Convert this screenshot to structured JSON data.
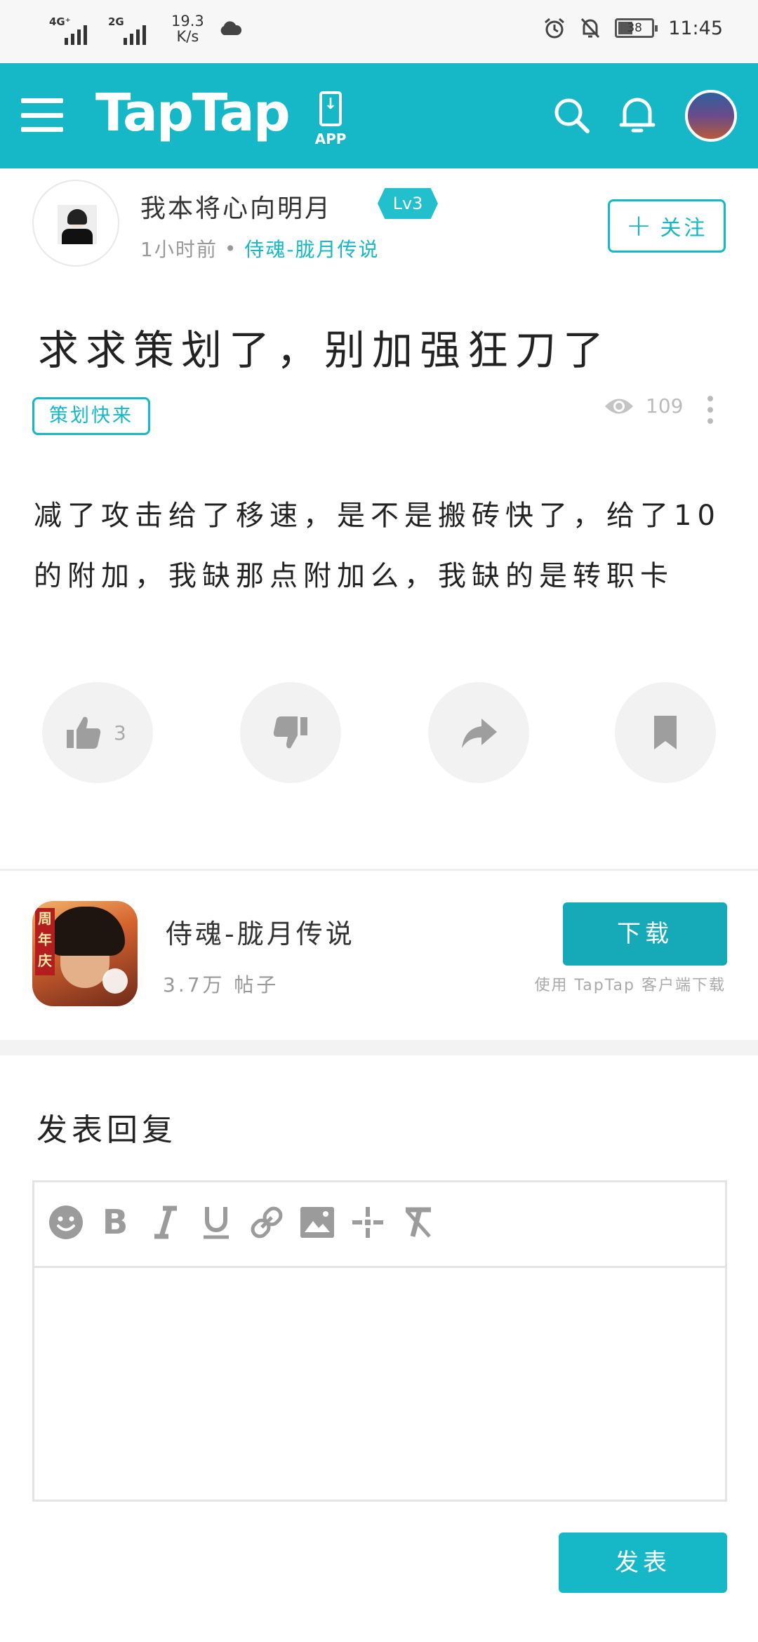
{
  "status_bar": {
    "network1": "4G⁺",
    "network2": "2G",
    "speed_value": "19.3",
    "speed_unit": "K/s",
    "battery": "38",
    "time": "11:45"
  },
  "header": {
    "brand": "TapTap",
    "app_label": "APP",
    "accent_color": "#16b8c7"
  },
  "post": {
    "author": "我本将心向明月",
    "level": "Lv3",
    "time_ago": "1小时前",
    "separator": "•",
    "game": "侍魂-胧月传说",
    "follow_label": "关注",
    "title": "求求策划了，别加强狂刀了",
    "tag": "策划快来",
    "views": "109",
    "body_line1": "减了攻击给了移速，是不是搬砖快了，给了10",
    "body_line2": "的附加，我缺那点附加么，我缺的是转职卡",
    "likes": "3"
  },
  "game_card": {
    "name": "侍魂-胧月传说",
    "posts": "3.7万 帖子",
    "download_label": "下载",
    "download_hint": "使用 TapTap 客户端下载",
    "icon_banner": "周年庆"
  },
  "reply": {
    "heading": "发表回复",
    "bold_label": "B",
    "publish_label": "发表"
  }
}
